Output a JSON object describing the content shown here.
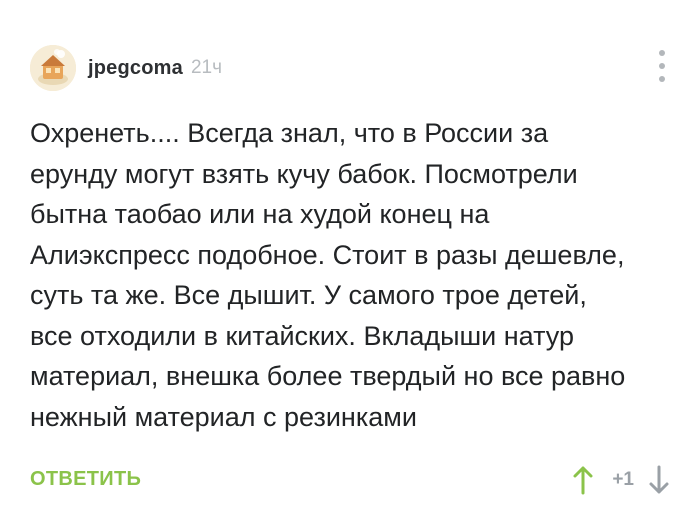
{
  "comment": {
    "author": "jpegcoma",
    "time": "21ч",
    "text": "Охренеть.... Всегда знал, что в России за\nерунду могут взять кучу бабок. Посмотрели\nбытна таобао или на худой конец на\nАлиэкспресс подобное. Стоит в разы дешевле,\nсуть та же. Все дышит. У самого трое детей,\nвсе отходили в китайских. Вкладыши натур\nматериал, внешка более твердый но все равно\nнежный материал с резинками",
    "reply_label": "ОТВЕТИТЬ",
    "score": "+1"
  },
  "colors": {
    "accent_green": "#8bc34a",
    "muted_gray": "#9aa0a6"
  },
  "icons": {
    "menu": "more-vertical-icon",
    "upvote": "arrow-up-icon",
    "downvote": "arrow-down-icon",
    "avatar": "avatar-image"
  }
}
